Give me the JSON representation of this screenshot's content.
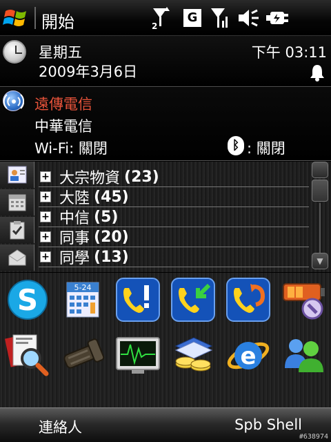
{
  "titlebar": {
    "title": "開始",
    "signal_sim_label": "2",
    "network_type": "G",
    "icons": [
      "start-windows-logo-icon",
      "signal-sim2-icon",
      "network-g-icon",
      "signal-icon",
      "speaker-icon",
      "battery-charging-icon"
    ]
  },
  "clock": {
    "day": "星期五",
    "date": "2009年3月6日",
    "time": "下午 03:11",
    "alarm_icon": "bell-icon"
  },
  "network": {
    "operator1": "遠傳電信",
    "operator1_color": "#e8533a",
    "operator2": "中華電信",
    "wifi_status": "Wi-Fi: 關閉",
    "bluetooth_status": ": 關閉"
  },
  "contacts": {
    "groups": [
      {
        "name": "大宗物資",
        "count": "(23)"
      },
      {
        "name": "大陸",
        "count": "(45)"
      },
      {
        "name": "中信",
        "count": "(5)"
      },
      {
        "name": "同事",
        "count": "(20)"
      },
      {
        "name": "同學",
        "count": "(13)"
      }
    ],
    "side_tabs": [
      "contacts-card-icon",
      "calendar-icon",
      "tasks-icon",
      "messaging-icon"
    ]
  },
  "apps": {
    "calendar_label": "5-24",
    "items": [
      "skype-icon",
      "calendar-icon",
      "phone-missed-call-icon",
      "phone-incoming-call-icon",
      "phone-outgoing-call-icon",
      "battery-tool-icon",
      "contact-search-icon",
      "flashlight-icon",
      "task-monitor-icon",
      "money-tool-icon",
      "internet-explorer-icon",
      "messenger-icon"
    ]
  },
  "softkeys": {
    "left": "連絡人",
    "right": "Spb Shell"
  },
  "watermark": "#638974"
}
